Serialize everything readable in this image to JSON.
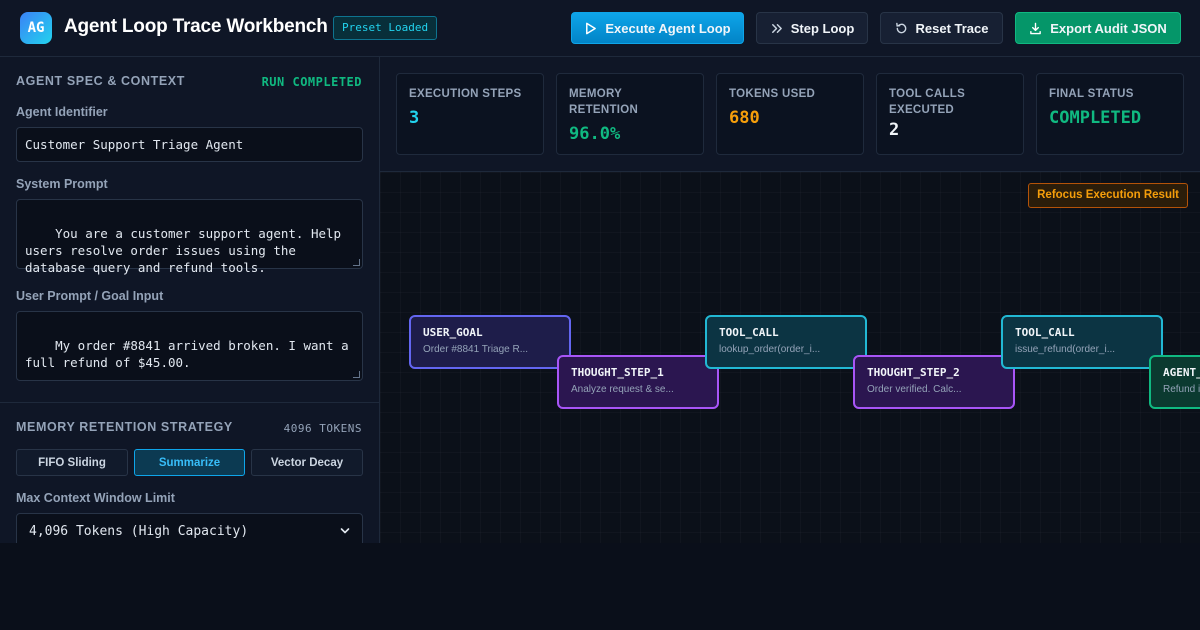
{
  "header": {
    "logo_text": "AG",
    "title": "Agent Loop Trace Workbench",
    "badge": "Preset Loaded",
    "buttons": {
      "execute": "Execute Agent Loop",
      "step": "Step Loop",
      "reset": "Reset Trace",
      "export": "Export Audit JSON"
    }
  },
  "left_panel": {
    "spec_section": {
      "title": "AGENT SPEC & CONTEXT",
      "status": "RUN COMPLETED",
      "agent_identifier_label": "Agent Identifier",
      "agent_identifier_value": "Customer Support Triage Agent",
      "system_prompt_label": "System Prompt",
      "system_prompt_value": "You are a customer support agent. Help\nusers resolve order issues using the\ndatabase query and refund tools.",
      "user_prompt_label": "User Prompt / Goal Input",
      "user_prompt_value": "My order #8841 arrived broken. I want a\nfull refund of $45.00."
    },
    "memory_section": {
      "title": "MEMORY RETENTION STRATEGY",
      "tokens": "4096 TOKENS",
      "strategies": [
        "FIFO Sliding",
        "Summarize",
        "Vector Decay"
      ],
      "active_strategy": "Summarize",
      "context_limit_label": "Max Context Window Limit",
      "context_limit_value": "4,096 Tokens (High Capacity)"
    }
  },
  "metrics": [
    {
      "label": "EXECUTION STEPS",
      "value": "3",
      "color": "#22d3ee"
    },
    {
      "label": "MEMORY RETENTION",
      "value": "96.0%",
      "color": "#10b981"
    },
    {
      "label": "TOKENS USED",
      "value": "680",
      "color": "#f59e0b"
    },
    {
      "label": "TOOL CALLS EXECUTED",
      "value": "2",
      "color": "#f1f5f9"
    },
    {
      "label": "FINAL STATUS",
      "value": "COMPLETED",
      "color": "#10b981"
    }
  ],
  "canvas": {
    "refocus_label": "Refocus Execution Result",
    "nodes": [
      {
        "title": "USER_GOAL",
        "subtitle": "Order #8841 Triage R...",
        "kind": "goal"
      },
      {
        "title": "THOUGHT_STEP_1",
        "subtitle": "Analyze request & se...",
        "kind": "thought"
      },
      {
        "title": "TOOL_CALL",
        "subtitle": "lookup_order(order_i...",
        "kind": "tool"
      },
      {
        "title": "THOUGHT_STEP_2",
        "subtitle": "Order verified. Calc...",
        "kind": "thought"
      },
      {
        "title": "TOOL_CALL",
        "subtitle": "issue_refund(order_i...",
        "kind": "tool"
      },
      {
        "title": "AGENT_",
        "subtitle": "Refund i",
        "kind": "agent"
      }
    ]
  }
}
